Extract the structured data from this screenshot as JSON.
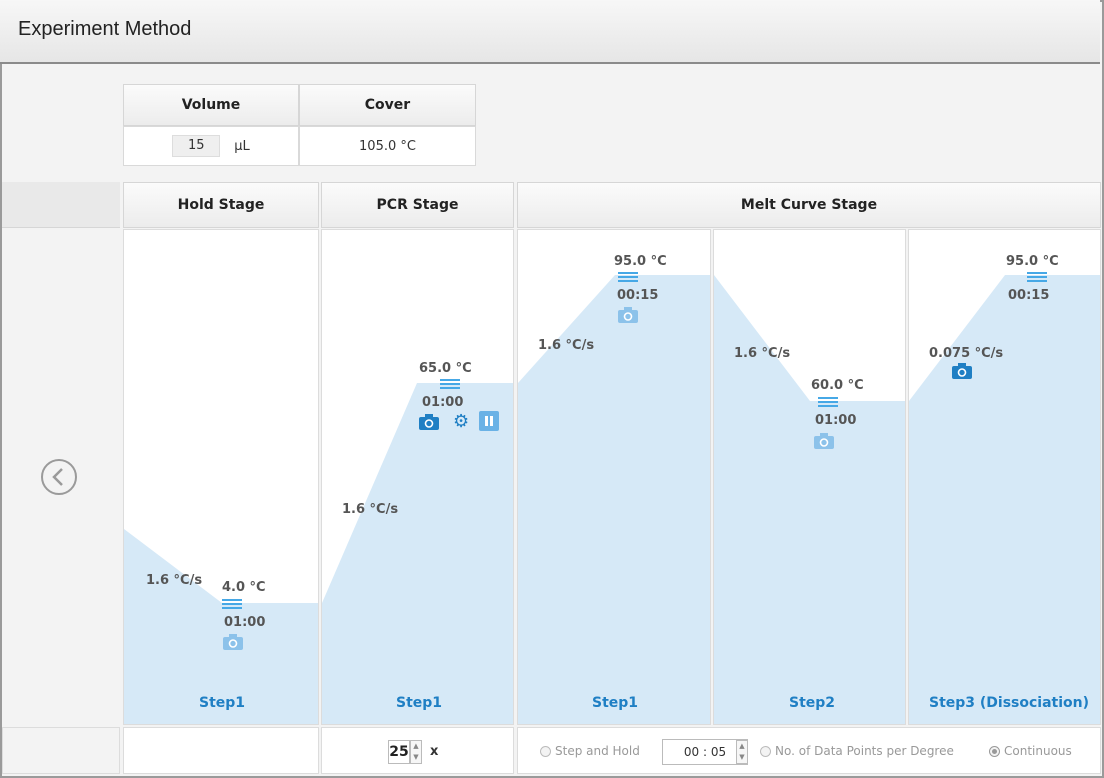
{
  "title": "Experiment Method",
  "settings": {
    "volume_header": "Volume",
    "cover_header": "Cover",
    "volume_value": "15",
    "volume_unit": "µL",
    "cover_value": "105.0 °C"
  },
  "stages": {
    "hold": "Hold Stage",
    "pcr": "PCR Stage",
    "melt": "Melt Curve Stage"
  },
  "steps": {
    "hold_step1": {
      "label": "Step1",
      "ramp": "1.6 °C/s",
      "temp": "4.0 °C",
      "time": "01:00"
    },
    "pcr_step1": {
      "label": "Step1",
      "ramp": "1.6 °C/s",
      "temp": "65.0 °C",
      "time": "01:00"
    },
    "melt_step1": {
      "label": "Step1",
      "ramp": "1.6 °C/s",
      "temp": "95.0 °C",
      "time": "00:15"
    },
    "melt_step2": {
      "label": "Step2",
      "ramp": "1.6 °C/s",
      "temp": "60.0 °C",
      "time": "01:00"
    },
    "melt_step3": {
      "label": "Step3 (Dissociation)",
      "ramp": "0.075 °C/s",
      "temp": "95.0 °C",
      "time": "00:15"
    }
  },
  "pcr_footer": {
    "cycles": "25",
    "suffix": "x"
  },
  "melt_footer": {
    "step_and_hold": "Step and Hold",
    "hold_time": "00 : 05",
    "data_points": "No. of Data Points per Degree",
    "continuous": "Continuous"
  },
  "colors": {
    "fill": "#d6e9f7",
    "accent": "#1f7fc4"
  }
}
